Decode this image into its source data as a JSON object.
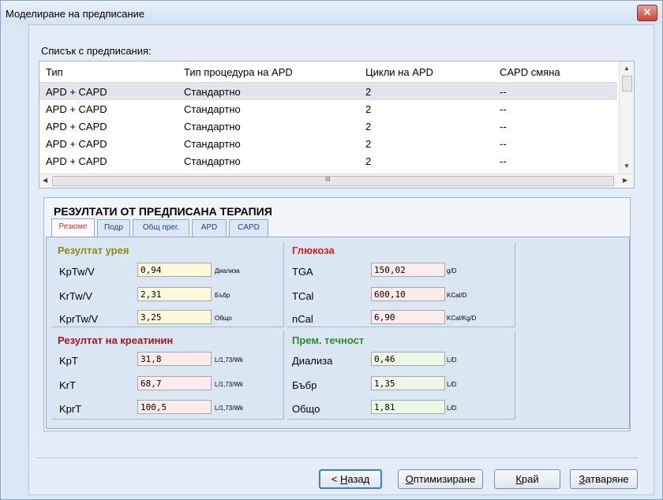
{
  "window": {
    "title": "Моделиране на предписание",
    "close_glyph": "✕"
  },
  "prescriptions": {
    "label": "Списък с предписания:",
    "columns": [
      "Тип",
      "Тип процедура на APD",
      "Цикли на APD",
      "CAPD смяна"
    ],
    "rows": [
      [
        "APD + CAPD",
        "Стандартно",
        "2",
        "--"
      ],
      [
        "APD + CAPD",
        "Стандартно",
        "2",
        "--"
      ],
      [
        "APD + CAPD",
        "Стандартно",
        "2",
        "--"
      ],
      [
        "APD + CAPD",
        "Стандартно",
        "2",
        "--"
      ],
      [
        "APD + CAPD",
        "Стандартно",
        "2",
        "--"
      ]
    ],
    "selected_row": 0,
    "hscroll_grip": "III"
  },
  "results": {
    "title": "РЕЗУЛТАТИ ОТ ПРЕДПИСАНА ТЕРАПИЯ",
    "tabs": [
      "Резюме",
      "Подр",
      "Общ прег.",
      "APD",
      "CAPD"
    ],
    "active_tab": 0,
    "urea": {
      "title": "Резултат урея",
      "rows": [
        {
          "label": "KpTw/V",
          "value": "0,94",
          "unit": "Диализа"
        },
        {
          "label": "KrTw/V",
          "value": "2,31",
          "unit": "Бъбр"
        },
        {
          "label": "KprTw/V",
          "value": "3,25",
          "unit": "Общо"
        }
      ]
    },
    "glucose": {
      "title": "Глюкоза",
      "rows": [
        {
          "label": "TGA",
          "value": "150,02",
          "unit": "g/D"
        },
        {
          "label": "TCal",
          "value": "600,10",
          "unit": "KCal/D"
        },
        {
          "label": "nCal",
          "value": "6,90",
          "unit": "KCal/Kg/D"
        }
      ]
    },
    "creatinine": {
      "title": "Резултат на креатинин",
      "rows": [
        {
          "label": "KpT",
          "value": "31,8",
          "unit": "L/1,73/Wk"
        },
        {
          "label": "KrT",
          "value": "68,7",
          "unit": "L/1,73/Wk"
        },
        {
          "label": "KprT",
          "value": "100,5",
          "unit": "L/1,73/Wk"
        }
      ]
    },
    "fluid": {
      "title": "Прем. течност",
      "rows": [
        {
          "label": "Диализа",
          "value": "0,46",
          "unit": "L/D"
        },
        {
          "label": "Бъбр",
          "value": "1,35",
          "unit": "L/D"
        },
        {
          "label": "Общо",
          "value": "1,81",
          "unit": "L/D"
        }
      ]
    }
  },
  "buttons": {
    "back": {
      "label": "< Назад",
      "accel": "Н"
    },
    "optimize": {
      "label": "Оптимизиране",
      "accel": "О"
    },
    "finish": {
      "label": "Край",
      "accel": "К"
    },
    "close": {
      "label": "Затваряне",
      "accel": "З"
    }
  },
  "colors": {
    "urea_title": "#8b8b1a",
    "glucose_title": "#d01f1f",
    "creatinine_title": "#a3171c",
    "fluid_title": "#2d8a2d"
  }
}
